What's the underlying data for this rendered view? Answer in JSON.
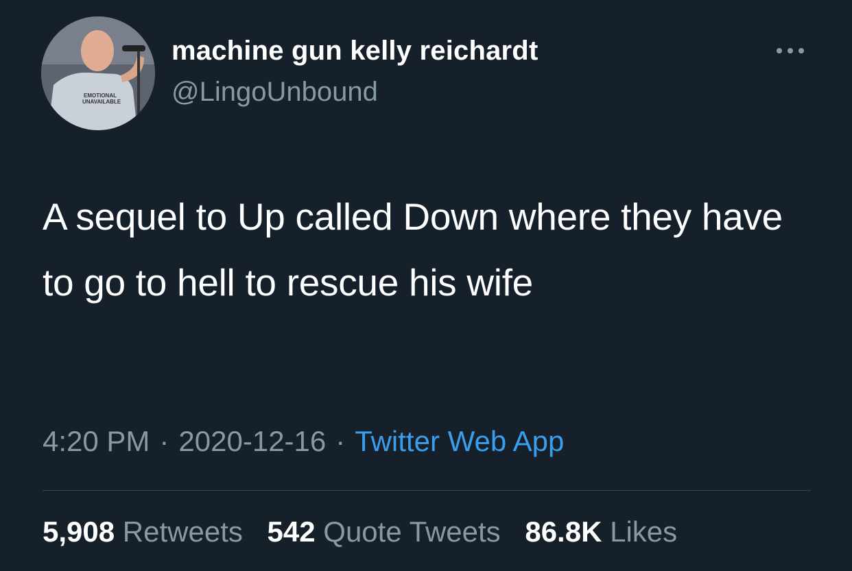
{
  "user": {
    "display_name": "machine gun kelly reichardt",
    "handle": "@LingoUnbound",
    "avatar_shirt_text": "EMOTIONALLY UNAVAILABLE"
  },
  "tweet": {
    "text": "A sequel to Up called Down where they have to go to hell to rescue his wife",
    "time": "4:20 PM",
    "date": "2020-12-16",
    "source": "Twitter Web App",
    "separator": "·"
  },
  "stats": {
    "retweets": {
      "count": "5,908",
      "label": "Retweets"
    },
    "quotes": {
      "count": "542",
      "label": "Quote Tweets"
    },
    "likes": {
      "count": "86.8K",
      "label": "Likes"
    }
  },
  "icons": {
    "more": "more-horizontal-icon"
  },
  "colors": {
    "background": "#15202b",
    "secondary_text": "#8899a6",
    "link": "#3a9eea",
    "divider": "#38444d"
  }
}
